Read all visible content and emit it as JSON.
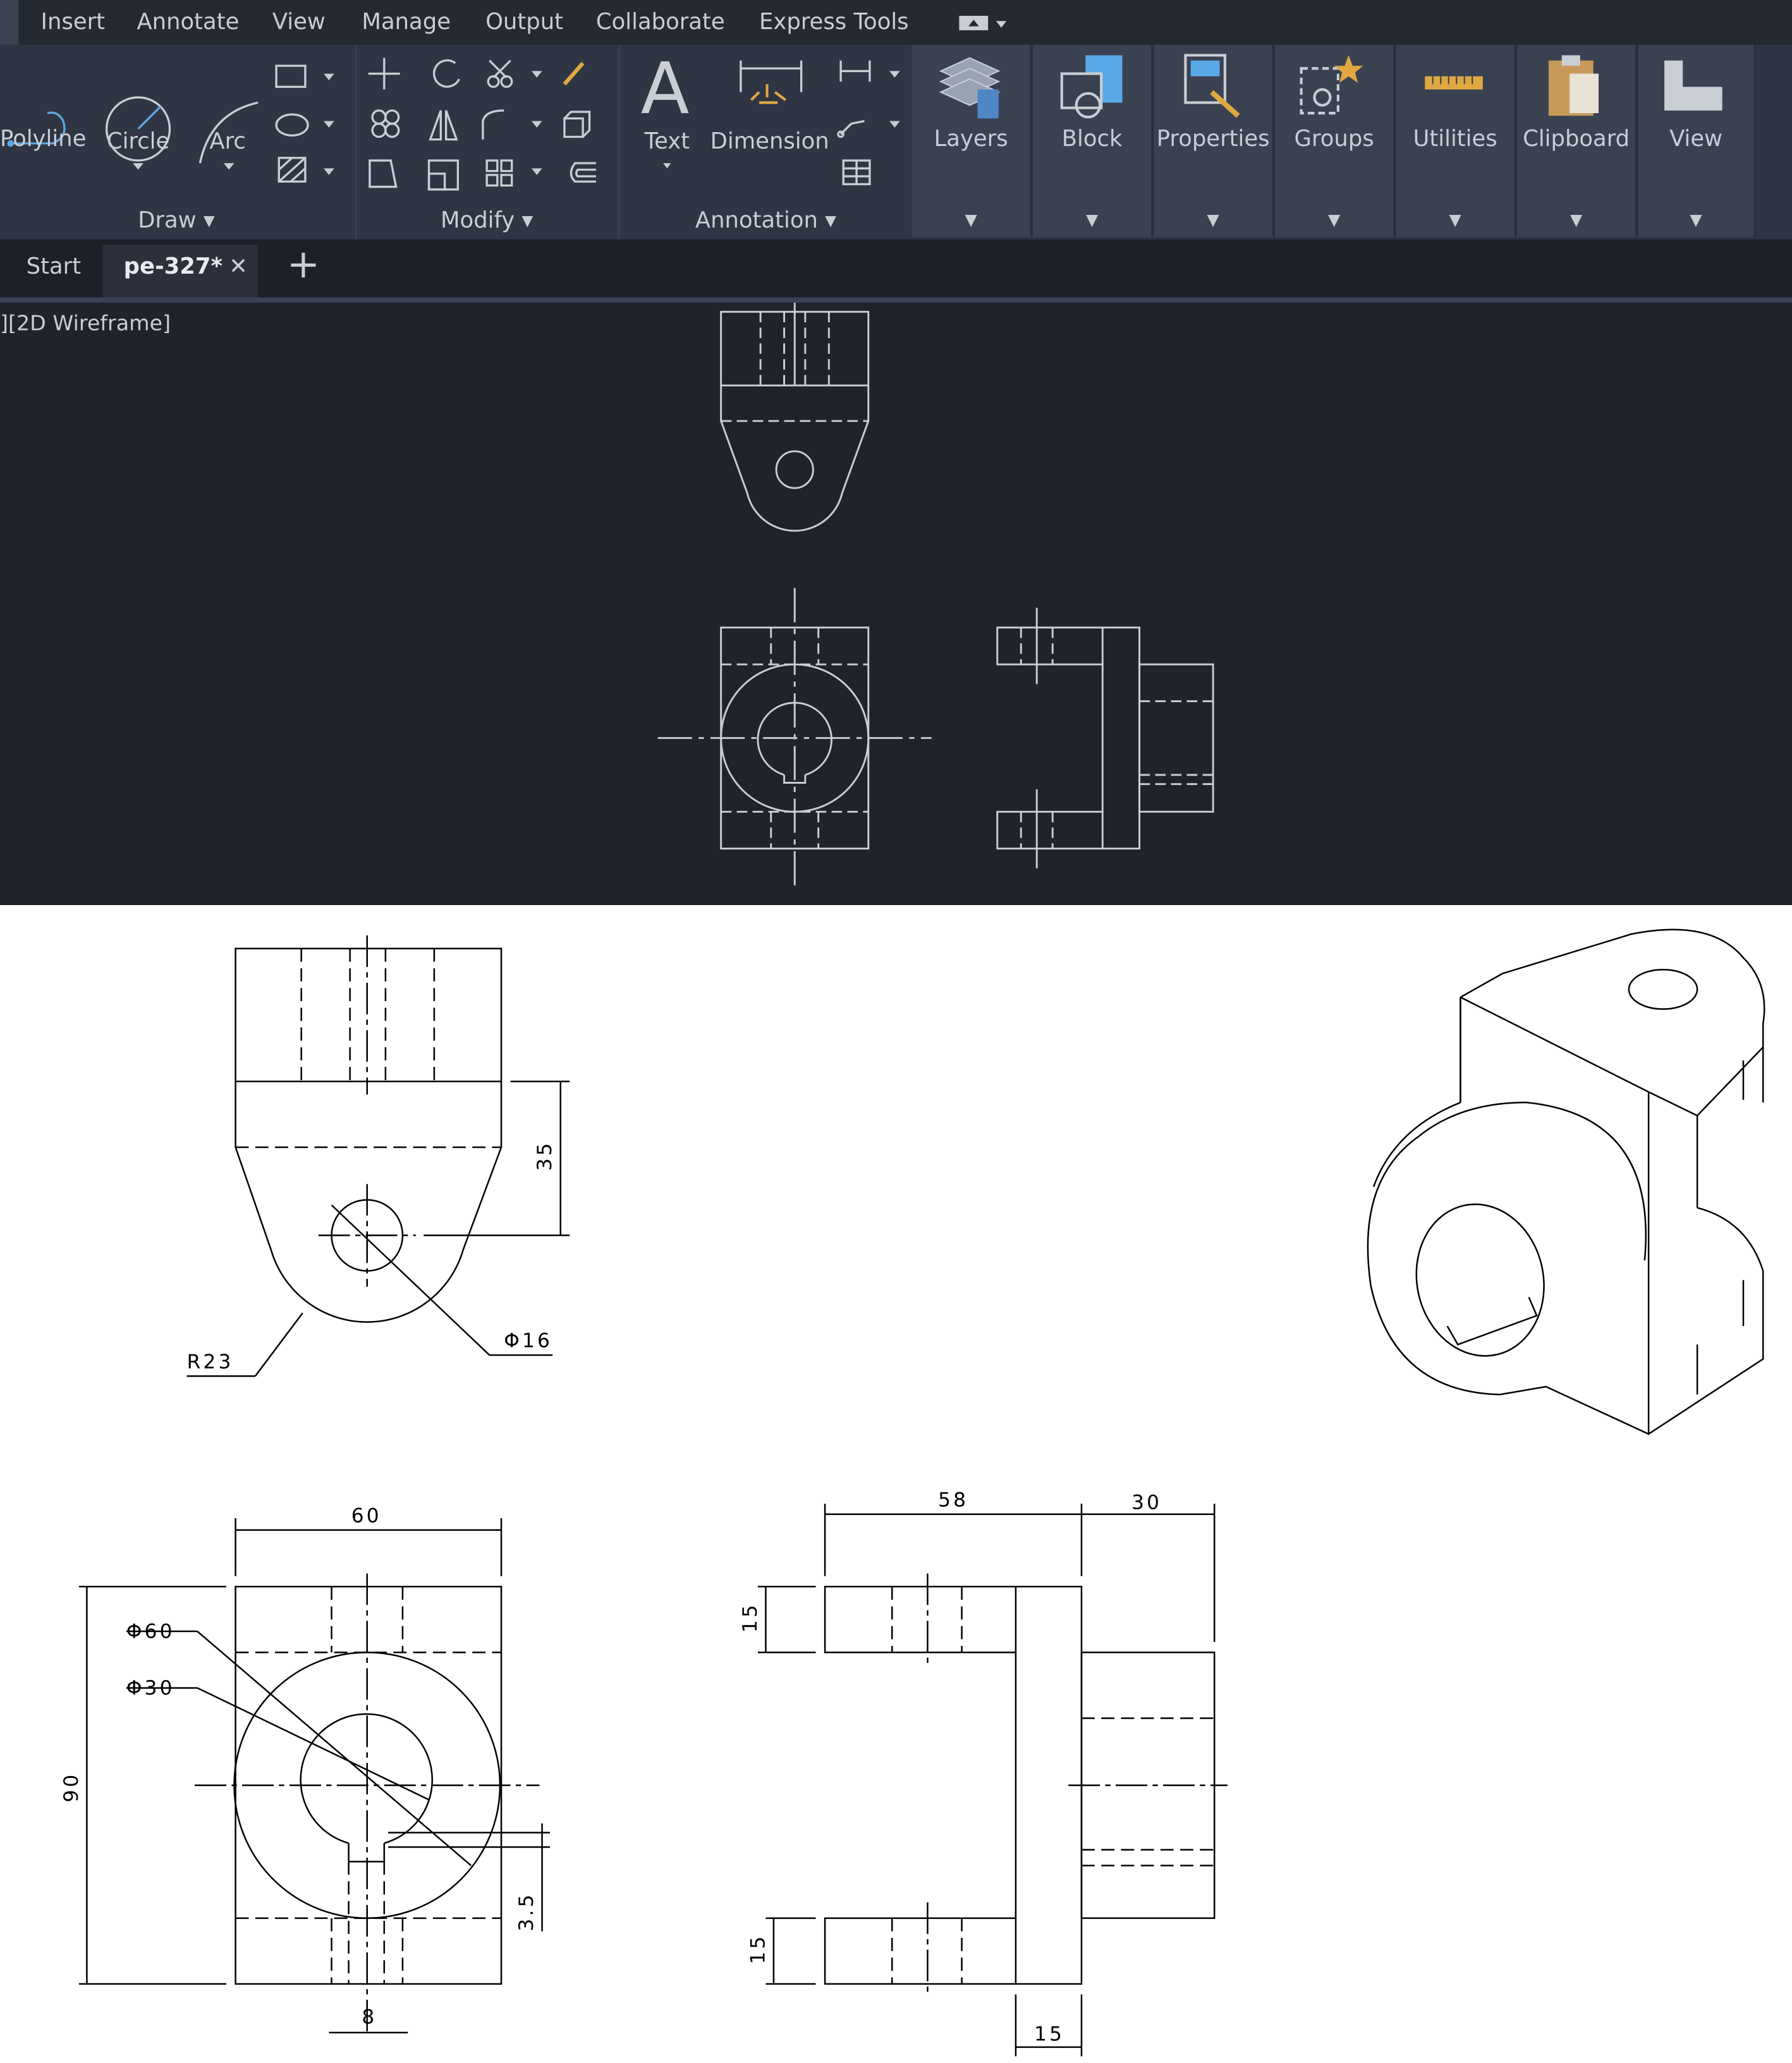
{
  "menu": {
    "items": [
      "Insert",
      "Annotate",
      "View",
      "Manage",
      "Output",
      "Collaborate",
      "Express Tools"
    ]
  },
  "ribbon": {
    "draw": {
      "polyline": "Polyline",
      "circle": "Circle",
      "arc": "Arc",
      "panel": "Draw"
    },
    "modify": {
      "panel": "Modify"
    },
    "annotation": {
      "text": "Text",
      "dimension": "Dimension",
      "panel": "Annotation"
    },
    "big_panels": [
      "Layers",
      "Block",
      "Properties",
      "Groups",
      "Utilities",
      "Clipboard",
      "View"
    ]
  },
  "tabs": {
    "start": "Start",
    "file": "pe-327*",
    "close": "✕",
    "add": "+"
  },
  "viewport": {
    "label": "][2D Wireframe]"
  },
  "colors": {
    "background": "#1f232c",
    "ribbon": "#2f3542",
    "panel": "#3a4252",
    "lines": "#c9cdd4"
  },
  "dimensions": {
    "top_height": "35",
    "top_hole": "Φ16",
    "top_radius": "R23",
    "front_width": "60",
    "front_height": "90",
    "front_outer": "Φ60",
    "front_inner": "Φ30",
    "key_depth": "3.5",
    "key_width": "8",
    "side_width": "58",
    "side_boss": "30",
    "side_top_lug": "15",
    "side_bottom_lug": "15",
    "side_plate": "15"
  }
}
